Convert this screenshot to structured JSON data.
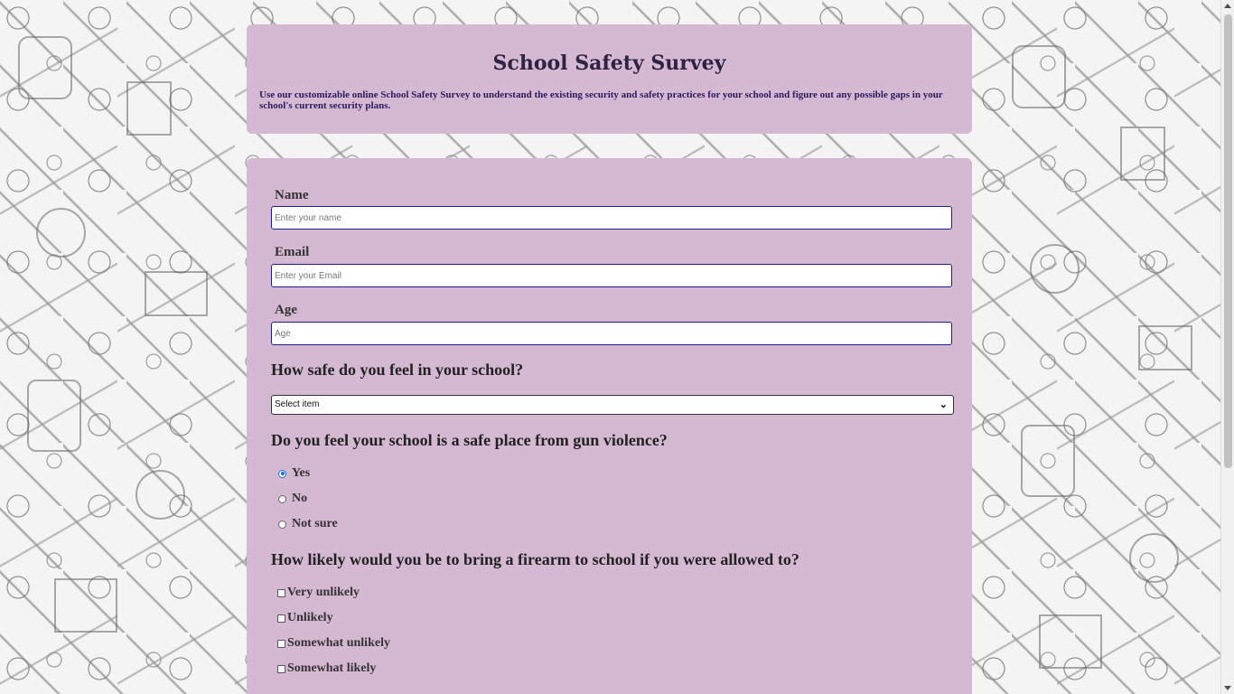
{
  "header": {
    "title": "School Safety Survey",
    "description": "Use our customizable online School Safety Survey to understand the existing security and safety practices for your school and figure out any possible gaps in your school's current security plans."
  },
  "form": {
    "name": {
      "label": "Name",
      "placeholder": "Enter your name"
    },
    "email": {
      "label": "Email",
      "placeholder": "Enter your Email"
    },
    "age": {
      "label": "Age",
      "placeholder": "Age"
    },
    "q1": {
      "question": "How safe do you feel in your school?",
      "selected": "Select item"
    },
    "q2": {
      "question": "Do you feel your school is a safe place from gun violence?",
      "options": [
        "Yes",
        "No",
        "Not sure"
      ],
      "selected": "Yes"
    },
    "q3": {
      "question": "How likely would you be to bring a firearm to school if you were allowed to?",
      "options": [
        "Very unlikely",
        "Unlikely",
        "Somewhat unlikely",
        "Somewhat likely"
      ]
    }
  },
  "icons": {
    "select_chevron": "chevron-down-icon",
    "scroll_up": "scroll-up-arrow-icon",
    "scroll_down": "scroll-down-arrow-icon"
  },
  "colors": {
    "card_background": "#d5b9d2",
    "input_border": "#1c1d8a",
    "title_text": "#2e2340",
    "description_text": "#2a1a5e",
    "radio_checked": "#1a6fd6"
  }
}
